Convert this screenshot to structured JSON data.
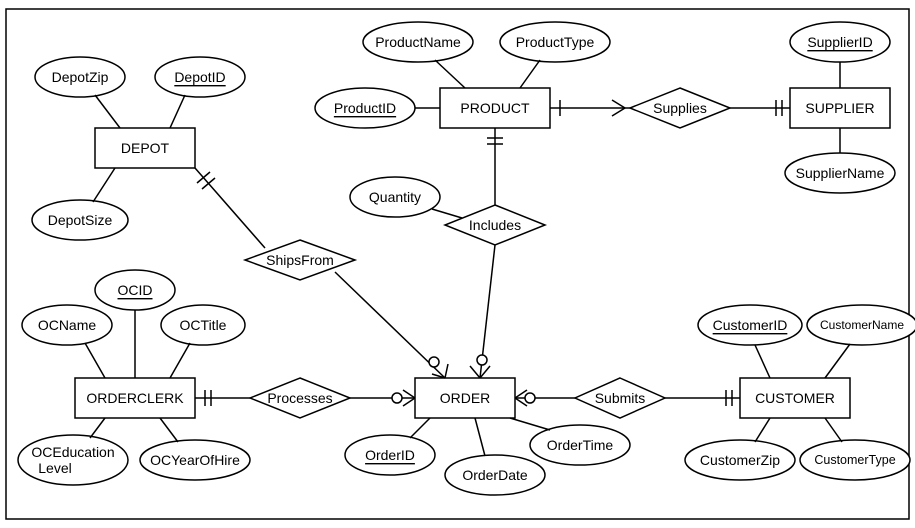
{
  "entities": {
    "depot": {
      "label": "DEPOT"
    },
    "product": {
      "label": "PRODUCT"
    },
    "supplier": {
      "label": "SUPPLIER"
    },
    "orderclerk": {
      "label": "ORDERCLERK"
    },
    "order": {
      "label": "ORDER"
    },
    "customer": {
      "label": "CUSTOMER"
    }
  },
  "attributes": {
    "depotZip": {
      "label": "DepotZip",
      "key": false
    },
    "depotID": {
      "label": "DepotID",
      "key": true
    },
    "depotSize": {
      "label": "DepotSize",
      "key": false
    },
    "productName": {
      "label": "ProductName",
      "key": false
    },
    "productType": {
      "label": "ProductType",
      "key": false
    },
    "productID": {
      "label": "ProductID",
      "key": true
    },
    "quantity": {
      "label": "Quantity",
      "key": false
    },
    "supplierID": {
      "label": "SupplierID",
      "key": true
    },
    "supplierName": {
      "label": "SupplierName",
      "key": false
    },
    "ocid": {
      "label": "OCID",
      "key": true
    },
    "ocName": {
      "label": "OCName",
      "key": false
    },
    "ocTitle": {
      "label": "OCTitle",
      "key": false
    },
    "ocEduLevel": {
      "label": "OCEducation Level",
      "key": false
    },
    "ocYearOfHire": {
      "label": "OCYearOfHire",
      "key": false
    },
    "orderID": {
      "label": "OrderID",
      "key": true
    },
    "orderDate": {
      "label": "OrderDate",
      "key": false
    },
    "orderTime": {
      "label": "OrderTime",
      "key": false
    },
    "customerID": {
      "label": "CustomerID",
      "key": true
    },
    "customerName": {
      "label": "CustomerName",
      "key": false
    },
    "customerZip": {
      "label": "CustomerZip",
      "key": false
    },
    "customerType": {
      "label": "CustomerType",
      "key": false
    }
  },
  "relationships": {
    "supplies": {
      "label": "Supplies"
    },
    "includes": {
      "label": "Includes"
    },
    "shipsFrom": {
      "label": "ShipsFrom"
    },
    "processes": {
      "label": "Processes"
    },
    "submits": {
      "label": "Submits"
    }
  }
}
